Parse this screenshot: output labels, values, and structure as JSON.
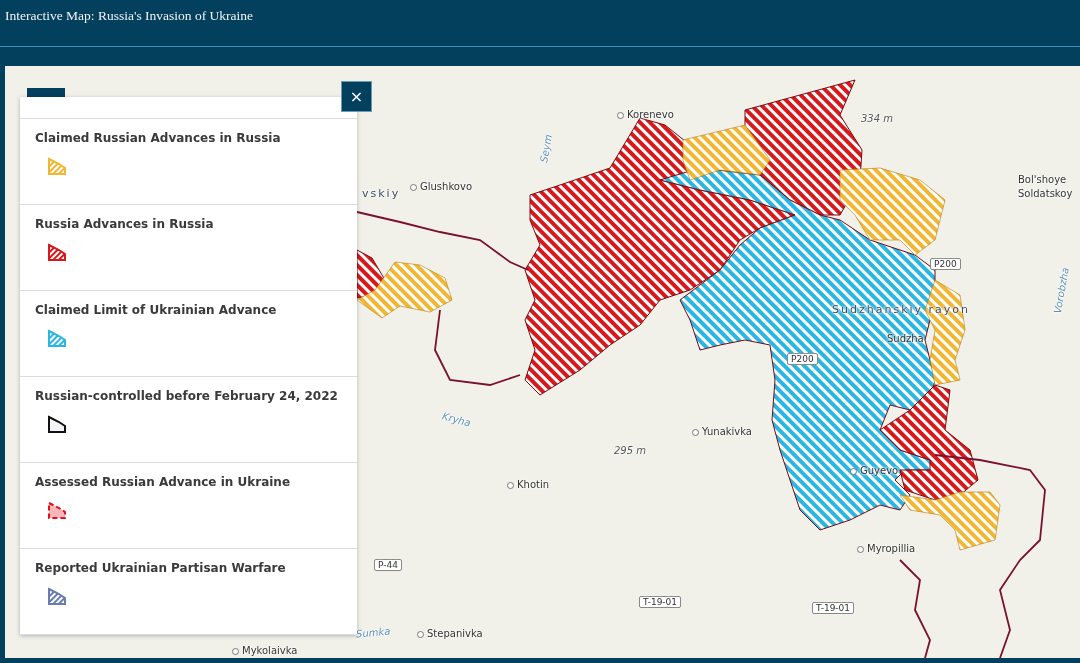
{
  "header": {
    "title": "Interactive Map: Russia's Invasion of Ukraine"
  },
  "legend": {
    "close": "×",
    "items": [
      {
        "label": "Claimed Russian Advances in Russia",
        "kind": "hatched",
        "color": "#f2b632"
      },
      {
        "label": "Russia Advances in Russia",
        "kind": "hatched",
        "color": "#d7191c"
      },
      {
        "label": "Claimed Limit of Ukrainian Advance",
        "kind": "hatched",
        "color": "#29b6e3"
      },
      {
        "label": "Russian-controlled before February 24, 2022",
        "kind": "outline",
        "color": "#111111"
      },
      {
        "label": "Assessed Russian Advance in Ukraine",
        "kind": "dashed",
        "color": "#e3101b"
      },
      {
        "label": "Reported Ukrainian Partisan Warfare",
        "kind": "hatched",
        "color": "#6a7bb0"
      }
    ]
  },
  "map": {
    "labels": [
      {
        "text": "Korenevo",
        "kind": "town"
      },
      {
        "text": "334 m",
        "kind": "peak"
      },
      {
        "text": "Glushkovo",
        "kind": "town"
      },
      {
        "text": "vskiy",
        "kind": "district"
      },
      {
        "text": "Bol'shoye",
        "kind": "text"
      },
      {
        "text": "Soldatskoy",
        "kind": "text"
      },
      {
        "text": "Seym",
        "kind": "river"
      },
      {
        "text": "P200",
        "kind": "road"
      },
      {
        "text": "Sudzhanskiy rayon",
        "kind": "district"
      },
      {
        "text": "Vorobzha",
        "kind": "river"
      },
      {
        "text": "P200",
        "kind": "road"
      },
      {
        "text": "Sudzha",
        "kind": "text"
      },
      {
        "text": "Kryha",
        "kind": "river"
      },
      {
        "text": "Yunakivka",
        "kind": "town"
      },
      {
        "text": "295 m",
        "kind": "peak"
      },
      {
        "text": "Guyevo",
        "kind": "town"
      },
      {
        "text": "Khotin",
        "kind": "town"
      },
      {
        "text": "Myropillia",
        "kind": "town"
      },
      {
        "text": "P-44",
        "kind": "road"
      },
      {
        "text": "T-19-01",
        "kind": "road"
      },
      {
        "text": "T-19-01",
        "kind": "road"
      },
      {
        "text": "Sumka",
        "kind": "river"
      },
      {
        "text": "Stepanivka",
        "kind": "town"
      },
      {
        "text": "Mykolaivka",
        "kind": "town"
      }
    ]
  }
}
